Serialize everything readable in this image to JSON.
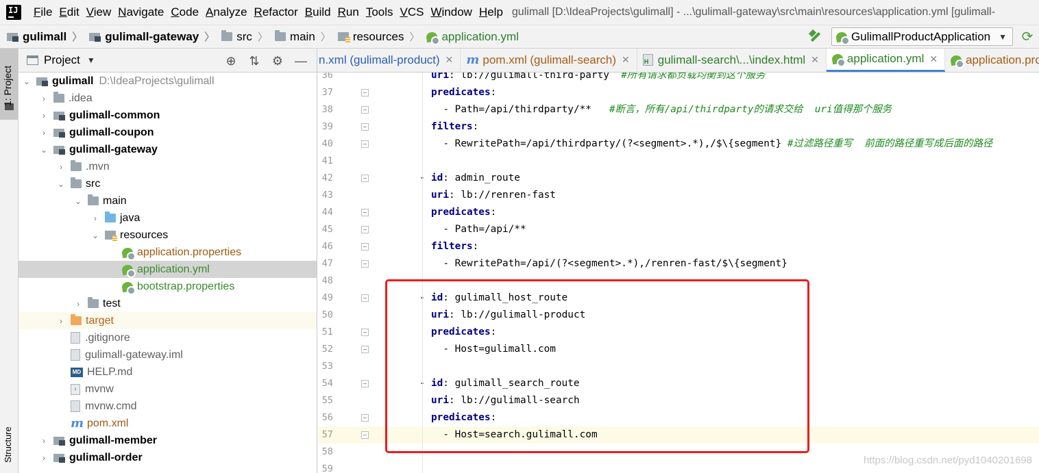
{
  "menu": {
    "items": [
      "File",
      "Edit",
      "View",
      "Navigate",
      "Code",
      "Analyze",
      "Refactor",
      "Build",
      "Run",
      "Tools",
      "VCS",
      "Window",
      "Help"
    ],
    "window_title": "gulimall [D:\\IdeaProjects\\gulimall] - ...\\gulimall-gateway\\src\\main\\resources\\application.yml [gulimall-"
  },
  "breadcrumb": [
    "gulimall",
    "gulimall-gateway",
    "src",
    "main",
    "resources",
    "application.yml"
  ],
  "run_config": {
    "label": "GulimallProductApplication"
  },
  "left_stripe": {
    "project": "1: Project",
    "structure": "Structure"
  },
  "project_panel": {
    "title": "Project",
    "tree": [
      {
        "label": "gulimall",
        "path": "D:\\IdeaProjects\\gulimall"
      },
      {
        "label": ".idea"
      },
      {
        "label": "gulimall-common"
      },
      {
        "label": "gulimall-coupon"
      },
      {
        "label": "gulimall-gateway"
      },
      {
        "label": ".mvn"
      },
      {
        "label": "src"
      },
      {
        "label": "main"
      },
      {
        "label": "java"
      },
      {
        "label": "resources"
      },
      {
        "label": "application.properties"
      },
      {
        "label": "application.yml"
      },
      {
        "label": "bootstrap.properties"
      },
      {
        "label": "test"
      },
      {
        "label": "target"
      },
      {
        "label": ".gitignore"
      },
      {
        "label": "gulimall-gateway.iml"
      },
      {
        "label": "HELP.md"
      },
      {
        "label": "mvnw"
      },
      {
        "label": "mvnw.cmd"
      },
      {
        "label": "pom.xml"
      },
      {
        "label": "gulimall-member"
      },
      {
        "label": "gulimall-order"
      }
    ]
  },
  "tabs": [
    {
      "label": "n.xml (gulimall-product)"
    },
    {
      "label": "pom.xml (gulimall-search)"
    },
    {
      "label": "gulimall-search\\...\\index.html"
    },
    {
      "label": "application.yml"
    },
    {
      "label": "application.prope"
    }
  ],
  "code": {
    "lines": [
      {
        "n": "36",
        "indent": 0,
        "parts": [
          [
            "kw",
            "uri"
          ],
          [
            "t",
            ": lb://gulimall-third-party  "
          ],
          [
            "cm",
            "#所有请求都负载均衡到这个服务"
          ]
        ]
      },
      {
        "n": "37",
        "indent": 0,
        "parts": [
          [
            "kw",
            "predicates"
          ],
          [
            "t",
            ":"
          ]
        ]
      },
      {
        "n": "38",
        "indent": 1,
        "parts": [
          [
            "t",
            "- Path=/api/thirdparty/**   "
          ],
          [
            "cm",
            "#断言，所有/api/thirdparty的请求交给  uri值得那个服务"
          ]
        ]
      },
      {
        "n": "39",
        "indent": 0,
        "parts": [
          [
            "kw",
            "filters"
          ],
          [
            "t",
            ":"
          ]
        ]
      },
      {
        "n": "40",
        "indent": 1,
        "parts": [
          [
            "t",
            "- RewritePath=/api/thirdparty/(?<segment>.*),/$\\{segment} "
          ],
          [
            "cm",
            "#过滤路径重写  前面的路径重写成后面的路径"
          ]
        ]
      },
      {
        "n": "41",
        "indent": 0,
        "parts": []
      },
      {
        "n": "42",
        "indent": -1,
        "parts": [
          [
            "t",
            "- "
          ],
          [
            "kw",
            "id"
          ],
          [
            "t",
            ": admin_route"
          ]
        ]
      },
      {
        "n": "43",
        "indent": 0,
        "parts": [
          [
            "kw",
            "uri"
          ],
          [
            "t",
            ": lb://renren-fast"
          ]
        ]
      },
      {
        "n": "44",
        "indent": 0,
        "parts": [
          [
            "kw",
            "predicates"
          ],
          [
            "t",
            ":"
          ]
        ]
      },
      {
        "n": "45",
        "indent": 1,
        "parts": [
          [
            "t",
            "- Path=/api/**"
          ]
        ]
      },
      {
        "n": "46",
        "indent": 0,
        "parts": [
          [
            "kw",
            "filters"
          ],
          [
            "t",
            ":"
          ]
        ]
      },
      {
        "n": "47",
        "indent": 1,
        "parts": [
          [
            "t",
            "- RewritePath=/api/(?<segment>.*),/renren-fast/$\\{segment}"
          ]
        ]
      },
      {
        "n": "48",
        "indent": 0,
        "parts": []
      },
      {
        "n": "49",
        "indent": -1,
        "parts": [
          [
            "t",
            "- "
          ],
          [
            "kw",
            "id"
          ],
          [
            "t",
            ": gulimall_host_route"
          ]
        ]
      },
      {
        "n": "50",
        "indent": 0,
        "parts": [
          [
            "kw",
            "uri"
          ],
          [
            "t",
            ": lb://gulimall-product"
          ]
        ]
      },
      {
        "n": "51",
        "indent": 0,
        "parts": [
          [
            "kw",
            "predicates"
          ],
          [
            "t",
            ":"
          ]
        ]
      },
      {
        "n": "52",
        "indent": 1,
        "parts": [
          [
            "t",
            "- Host=gulimall.com"
          ]
        ]
      },
      {
        "n": "53",
        "indent": 0,
        "parts": []
      },
      {
        "n": "54",
        "indent": -1,
        "parts": [
          [
            "t",
            "- "
          ],
          [
            "kw",
            "id"
          ],
          [
            "t",
            ": gulimall_search_route"
          ]
        ]
      },
      {
        "n": "55",
        "indent": 0,
        "parts": [
          [
            "kw",
            "uri"
          ],
          [
            "t",
            ": lb://gulimall-search"
          ]
        ]
      },
      {
        "n": "56",
        "indent": 0,
        "parts": [
          [
            "kw",
            "predicates"
          ],
          [
            "t",
            ":"
          ]
        ]
      },
      {
        "n": "57",
        "indent": 1,
        "parts": [
          [
            "t",
            "- Host=search.gulimall.com"
          ]
        ]
      },
      {
        "n": "58",
        "indent": 0,
        "parts": []
      },
      {
        "n": "59",
        "indent": 0,
        "parts": []
      }
    ]
  },
  "watermark": "https://blog.csdn.net/pyd1040201698"
}
